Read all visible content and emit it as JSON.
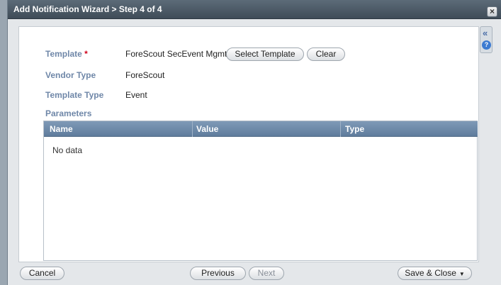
{
  "dialog": {
    "title": "Add Notification Wizard > Step 4 of 4",
    "close_label": "×"
  },
  "side_panel": {
    "collapse_glyph": "«",
    "help_glyph": "?"
  },
  "form": {
    "template_label": "Template",
    "required_marker": "*",
    "template_value": "ForeScout SecEvent Mgmt",
    "select_template_label": "Select Template",
    "clear_label": "Clear",
    "vendor_type_label": "Vendor Type",
    "vendor_type_value": "ForeScout",
    "template_type_label": "Template Type",
    "template_type_value": "Event",
    "parameters_label": "Parameters"
  },
  "grid": {
    "columns": [
      "Name",
      "Value",
      "Type"
    ],
    "rows": [],
    "empty_text": "No data"
  },
  "footer": {
    "cancel_label": "Cancel",
    "previous_label": "Previous",
    "next_label": "Next",
    "save_close_label": "Save & Close",
    "save_close_caret": "▼"
  }
}
